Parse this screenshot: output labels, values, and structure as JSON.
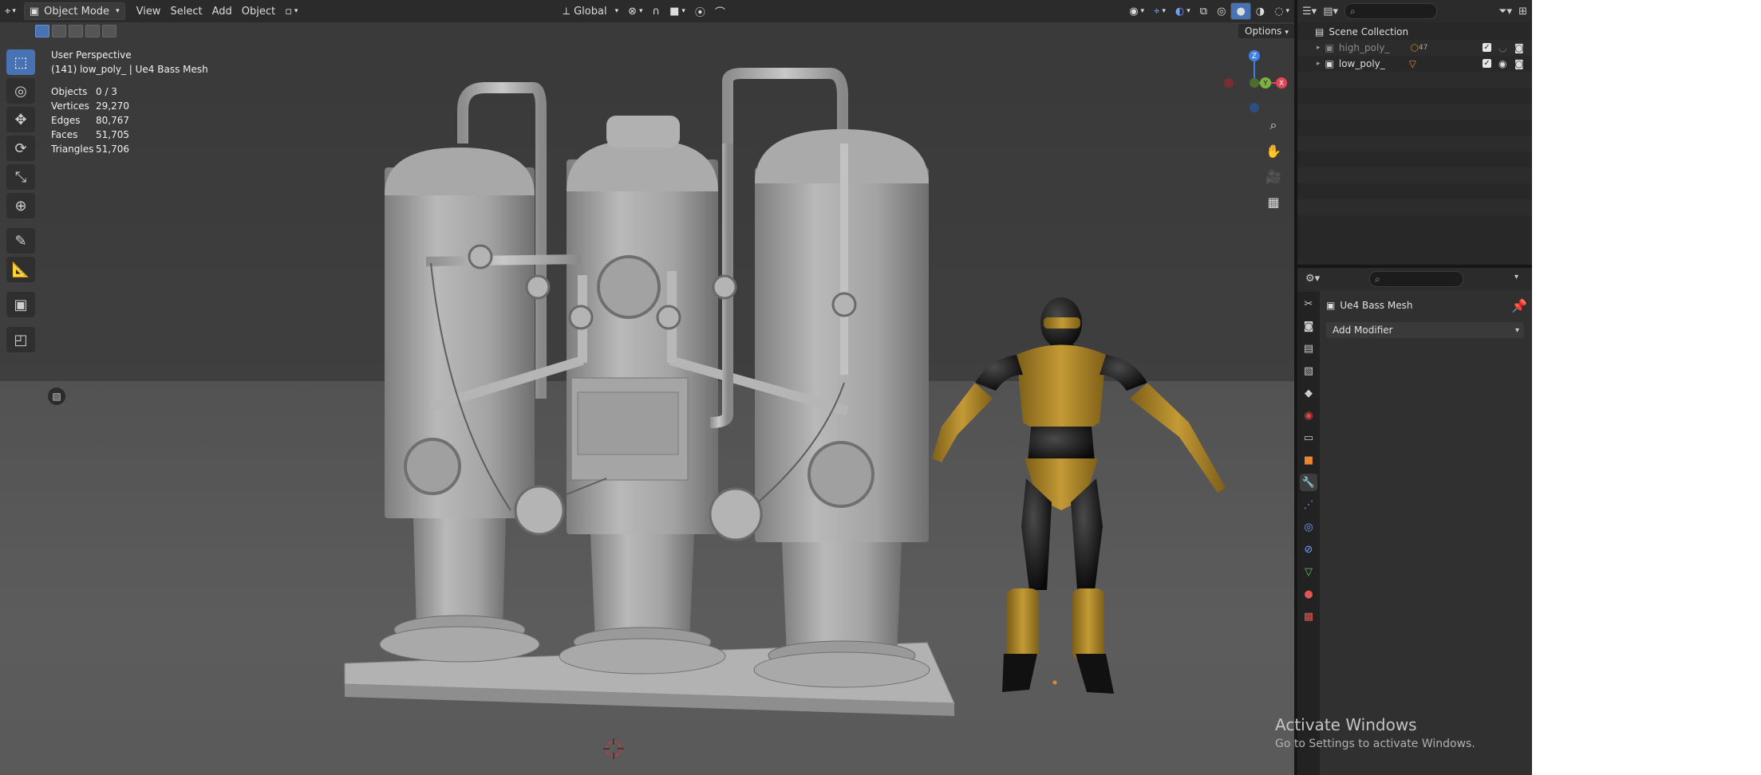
{
  "header": {
    "mode": "Object Mode",
    "menu": [
      "View",
      "Select",
      "Add",
      "Object"
    ],
    "transform_orientation": "Global"
  },
  "viewport": {
    "view_name": "User Perspective",
    "active_object": "(141) low_poly_ | Ue4 Bass Mesh",
    "stats": [
      {
        "label": "Objects",
        "value": "0 / 3"
      },
      {
        "label": "Vertices",
        "value": "29,270"
      },
      {
        "label": "Edges",
        "value": "80,767"
      },
      {
        "label": "Faces",
        "value": "51,705"
      },
      {
        "label": "Triangles",
        "value": "51,706"
      }
    ],
    "options_label": "Options",
    "gizmo_axes": {
      "x": "X",
      "y": "Y",
      "z": "Z"
    },
    "axis_colors": {
      "x": "#e64456",
      "y": "#7fb341",
      "z": "#3f7ee6"
    }
  },
  "outliner": {
    "root": "Scene Collection",
    "items": [
      {
        "name": "high_poly_",
        "count": "47"
      },
      {
        "name": "low_poly_",
        "count": ""
      }
    ]
  },
  "properties": {
    "object_name": "Ue4 Bass Mesh",
    "add_modifier_label": "Add Modifier"
  },
  "watermark": {
    "title": "Activate Windows",
    "subtitle": "Go to Settings to activate Windows."
  },
  "colors": {
    "accent": "#4772b3",
    "char_gold": "#b08a2a"
  }
}
